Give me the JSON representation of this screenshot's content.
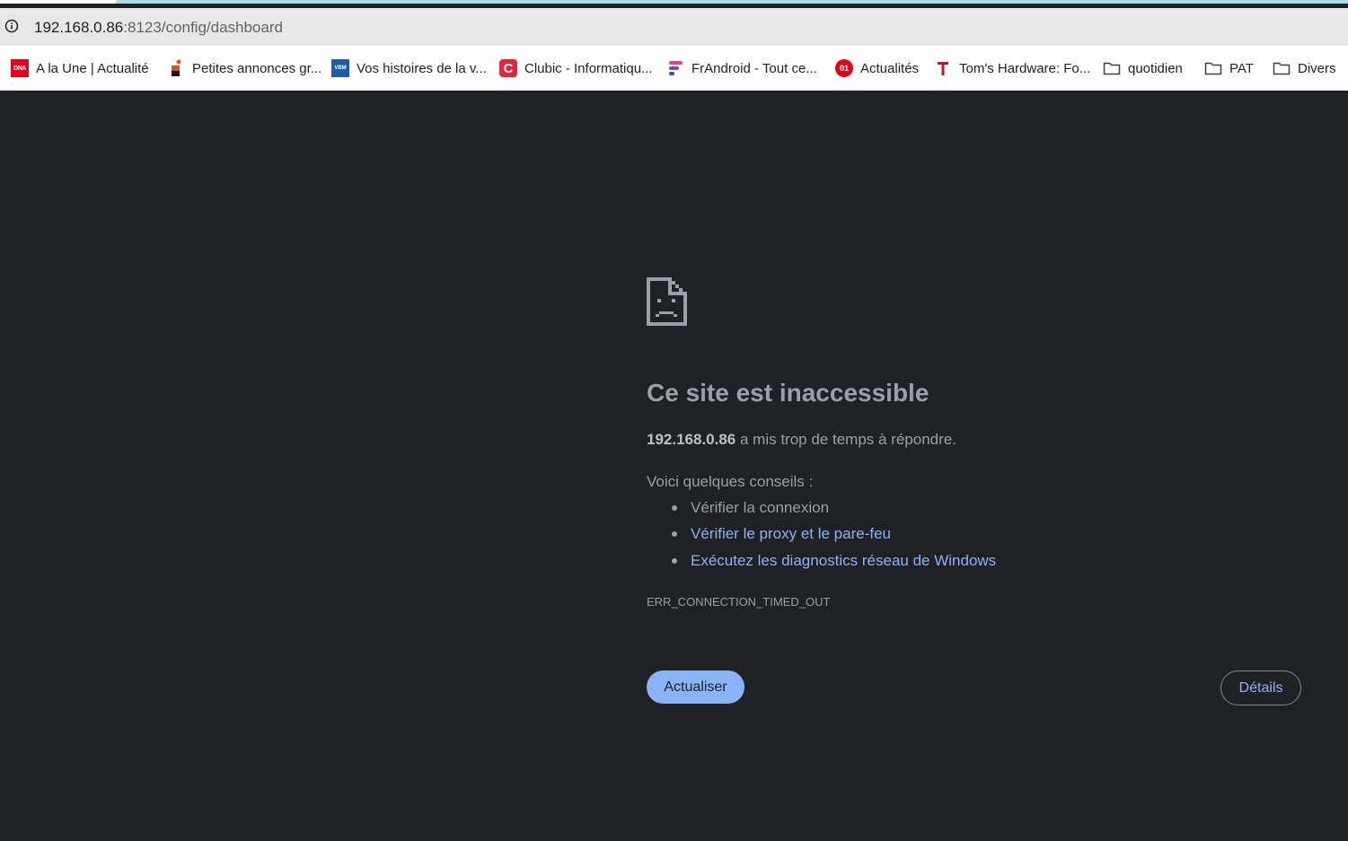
{
  "browser": {
    "url_host": "192.168.0.86",
    "url_rest": ":8123/config/dashboard",
    "bookmarks": [
      {
        "label": "A la Une | Actualité",
        "favicon": "dna-favicon",
        "favicon_text": "DNA"
      },
      {
        "label": "Petites annonces gr...",
        "favicon": "leboncoin-favicon"
      },
      {
        "label": "Vos histoires de la v...",
        "favicon": "vbm-favicon",
        "favicon_text": "VBM"
      },
      {
        "label": "Clubic - Informatiqu...",
        "favicon": "clubic-favicon",
        "favicon_text": "C"
      },
      {
        "label": "FrAndroid - Tout ce...",
        "favicon": "frandroid-favicon"
      },
      {
        "label": "Actualités",
        "favicon": "01net-favicon",
        "favicon_text": "01"
      },
      {
        "label": "Tom's Hardware: Fo...",
        "favicon": "toms-hardware-favicon"
      },
      {
        "label": "quotidien",
        "favicon": "folder-icon"
      },
      {
        "label": "PAT",
        "favicon": "folder-icon"
      },
      {
        "label": "Divers",
        "favicon": "folder-icon"
      }
    ]
  },
  "error_page": {
    "title": "Ce site est inaccessible",
    "host": "192.168.0.86",
    "message": " a mis trop de temps à répondre.",
    "tips_title": "Voici quelques conseils :",
    "tips": [
      {
        "text": "Vérifier la connexion",
        "link": false
      },
      {
        "text": "Vérifier le proxy et le pare-feu",
        "link": true
      },
      {
        "text": "Exécutez les diagnostics réseau de Windows",
        "link": true
      }
    ],
    "error_code": "ERR_CONNECTION_TIMED_OUT",
    "reload_label": "Actualiser",
    "details_label": "Détails"
  },
  "colors": {
    "background": "#202124",
    "text": "#9aa0a6",
    "link": "#8ab4f8",
    "button": "#8ab4f8"
  }
}
